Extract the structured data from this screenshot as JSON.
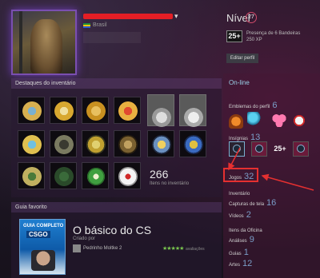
{
  "profile": {
    "country": "Brasil",
    "name_dropdown_caret": "▾"
  },
  "level": {
    "label": "Nível",
    "value": "27",
    "xp_badge": "25+",
    "xp_line1": "Presença de 6 Bandeiras",
    "xp_line2": "250 XP",
    "edit_button": "Editar perfil"
  },
  "side": {
    "online": "On-line",
    "stats": [
      {
        "label": "Emblemas do perfil",
        "count": "6"
      },
      {
        "label": "Insígnias",
        "count": "13"
      },
      {
        "label": "Jogos",
        "count": "32"
      },
      {
        "label": "Inventário",
        "count": ""
      },
      {
        "label": "Capturas de tela",
        "count": "16"
      },
      {
        "label": "Vídeos",
        "count": "2"
      },
      {
        "label": "Itens da Oficina",
        "count": ""
      },
      {
        "label": "Análises",
        "count": "9"
      },
      {
        "label": "Guias",
        "count": "1"
      },
      {
        "label": "Artes",
        "count": "12"
      }
    ],
    "xp_mini": "25+",
    "highlight_color": "#e53030"
  },
  "showcase": {
    "header": "Destaques do inventário",
    "item_count": "266",
    "item_count_label": "Itens no inventário"
  },
  "favourite": {
    "header": "Guia favorito",
    "thumb_line1": "GUIA COMPLETO",
    "thumb_line2": "CSGO",
    "title": "O básico do CS",
    "subtitle": "Criado por",
    "author": "Pedrinho Moltke 2",
    "stars": "★★★★★",
    "rating_label": "avaliações"
  }
}
